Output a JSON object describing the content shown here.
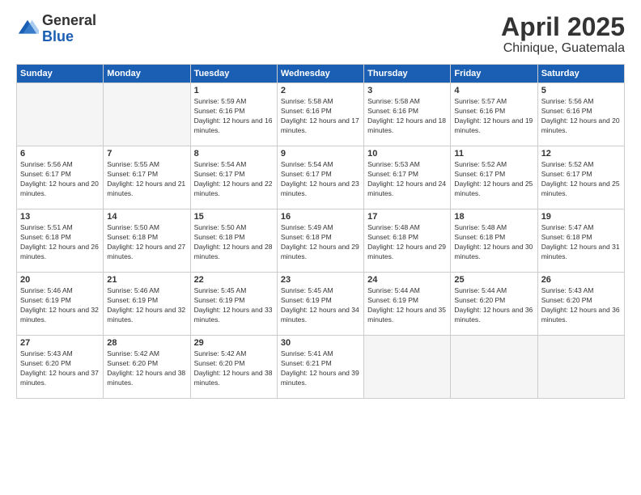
{
  "logo": {
    "general": "General",
    "blue": "Blue"
  },
  "title": "April 2025",
  "subtitle": "Chinique, Guatemala",
  "days_header": [
    "Sunday",
    "Monday",
    "Tuesday",
    "Wednesday",
    "Thursday",
    "Friday",
    "Saturday"
  ],
  "weeks": [
    [
      {
        "day": "",
        "empty": true
      },
      {
        "day": "",
        "empty": true
      },
      {
        "day": "1",
        "sunrise": "5:59 AM",
        "sunset": "6:16 PM",
        "daylight": "12 hours and 16 minutes."
      },
      {
        "day": "2",
        "sunrise": "5:58 AM",
        "sunset": "6:16 PM",
        "daylight": "12 hours and 17 minutes."
      },
      {
        "day": "3",
        "sunrise": "5:58 AM",
        "sunset": "6:16 PM",
        "daylight": "12 hours and 18 minutes."
      },
      {
        "day": "4",
        "sunrise": "5:57 AM",
        "sunset": "6:16 PM",
        "daylight": "12 hours and 19 minutes."
      },
      {
        "day": "5",
        "sunrise": "5:56 AM",
        "sunset": "6:16 PM",
        "daylight": "12 hours and 20 minutes."
      }
    ],
    [
      {
        "day": "6",
        "sunrise": "5:56 AM",
        "sunset": "6:17 PM",
        "daylight": "12 hours and 20 minutes."
      },
      {
        "day": "7",
        "sunrise": "5:55 AM",
        "sunset": "6:17 PM",
        "daylight": "12 hours and 21 minutes."
      },
      {
        "day": "8",
        "sunrise": "5:54 AM",
        "sunset": "6:17 PM",
        "daylight": "12 hours and 22 minutes."
      },
      {
        "day": "9",
        "sunrise": "5:54 AM",
        "sunset": "6:17 PM",
        "daylight": "12 hours and 23 minutes."
      },
      {
        "day": "10",
        "sunrise": "5:53 AM",
        "sunset": "6:17 PM",
        "daylight": "12 hours and 24 minutes."
      },
      {
        "day": "11",
        "sunrise": "5:52 AM",
        "sunset": "6:17 PM",
        "daylight": "12 hours and 25 minutes."
      },
      {
        "day": "12",
        "sunrise": "5:52 AM",
        "sunset": "6:17 PM",
        "daylight": "12 hours and 25 minutes."
      }
    ],
    [
      {
        "day": "13",
        "sunrise": "5:51 AM",
        "sunset": "6:18 PM",
        "daylight": "12 hours and 26 minutes."
      },
      {
        "day": "14",
        "sunrise": "5:50 AM",
        "sunset": "6:18 PM",
        "daylight": "12 hours and 27 minutes."
      },
      {
        "day": "15",
        "sunrise": "5:50 AM",
        "sunset": "6:18 PM",
        "daylight": "12 hours and 28 minutes."
      },
      {
        "day": "16",
        "sunrise": "5:49 AM",
        "sunset": "6:18 PM",
        "daylight": "12 hours and 29 minutes."
      },
      {
        "day": "17",
        "sunrise": "5:48 AM",
        "sunset": "6:18 PM",
        "daylight": "12 hours and 29 minutes."
      },
      {
        "day": "18",
        "sunrise": "5:48 AM",
        "sunset": "6:18 PM",
        "daylight": "12 hours and 30 minutes."
      },
      {
        "day": "19",
        "sunrise": "5:47 AM",
        "sunset": "6:18 PM",
        "daylight": "12 hours and 31 minutes."
      }
    ],
    [
      {
        "day": "20",
        "sunrise": "5:46 AM",
        "sunset": "6:19 PM",
        "daylight": "12 hours and 32 minutes."
      },
      {
        "day": "21",
        "sunrise": "5:46 AM",
        "sunset": "6:19 PM",
        "daylight": "12 hours and 32 minutes."
      },
      {
        "day": "22",
        "sunrise": "5:45 AM",
        "sunset": "6:19 PM",
        "daylight": "12 hours and 33 minutes."
      },
      {
        "day": "23",
        "sunrise": "5:45 AM",
        "sunset": "6:19 PM",
        "daylight": "12 hours and 34 minutes."
      },
      {
        "day": "24",
        "sunrise": "5:44 AM",
        "sunset": "6:19 PM",
        "daylight": "12 hours and 35 minutes."
      },
      {
        "day": "25",
        "sunrise": "5:44 AM",
        "sunset": "6:20 PM",
        "daylight": "12 hours and 36 minutes."
      },
      {
        "day": "26",
        "sunrise": "5:43 AM",
        "sunset": "6:20 PM",
        "daylight": "12 hours and 36 minutes."
      }
    ],
    [
      {
        "day": "27",
        "sunrise": "5:43 AM",
        "sunset": "6:20 PM",
        "daylight": "12 hours and 37 minutes."
      },
      {
        "day": "28",
        "sunrise": "5:42 AM",
        "sunset": "6:20 PM",
        "daylight": "12 hours and 38 minutes."
      },
      {
        "day": "29",
        "sunrise": "5:42 AM",
        "sunset": "6:20 PM",
        "daylight": "12 hours and 38 minutes."
      },
      {
        "day": "30",
        "sunrise": "5:41 AM",
        "sunset": "6:21 PM",
        "daylight": "12 hours and 39 minutes."
      },
      {
        "day": "",
        "empty": true
      },
      {
        "day": "",
        "empty": true
      },
      {
        "day": "",
        "empty": true
      }
    ]
  ]
}
